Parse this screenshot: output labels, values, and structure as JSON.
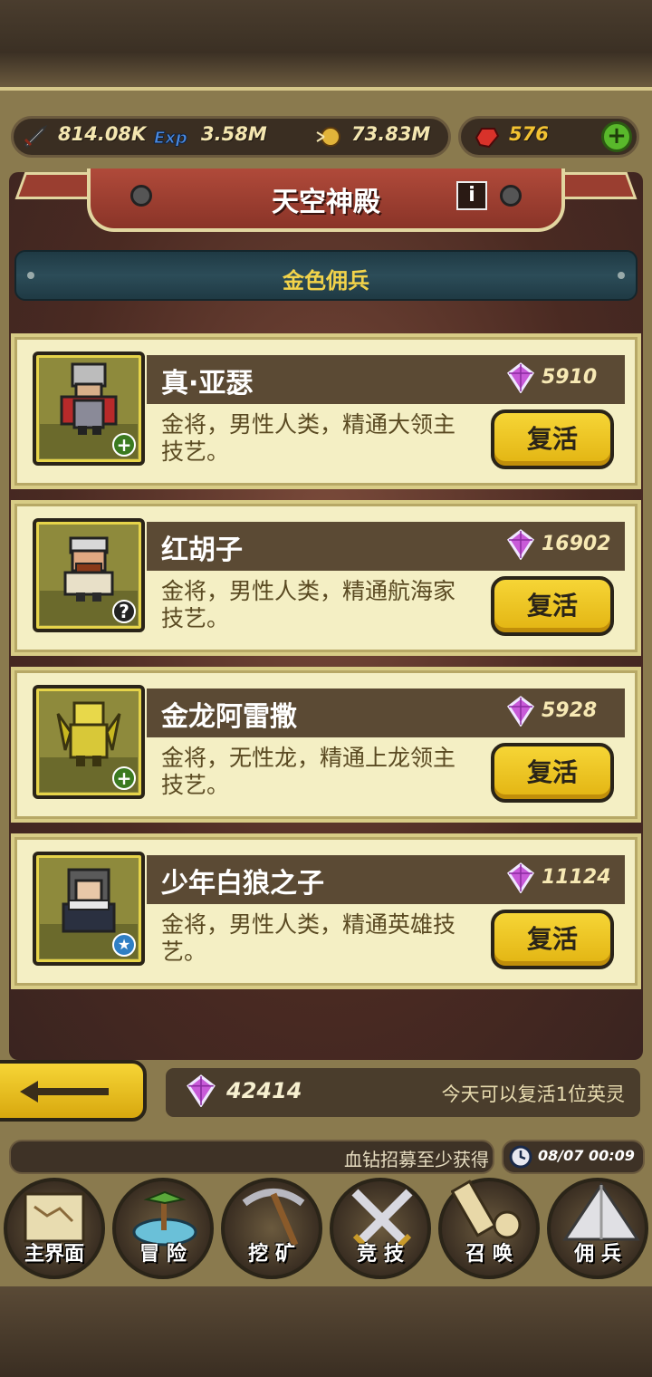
{
  "resources": {
    "attack": "814.08K",
    "exp": "3.58M",
    "gold": "73.83M",
    "gems": "576",
    "add_label": "+"
  },
  "header": {
    "title": "天空神殿",
    "info_label": "i",
    "subtitle": "金色佣兵"
  },
  "heroes": [
    {
      "name": "真·亚瑟",
      "cost": "5910",
      "desc": "金将，男性人类，精通大领主技艺。",
      "badge": "+",
      "button": "复活"
    },
    {
      "name": "红胡子",
      "cost": "16902",
      "desc": "金将，男性人类，精通航海家技艺。",
      "badge": "?",
      "button": "复活"
    },
    {
      "name": "金龙阿雷撒",
      "cost": "5928",
      "desc": "金将，无性龙，精通上龙领主技艺。",
      "badge": "+",
      "button": "复活"
    },
    {
      "name": "少年白狼之子",
      "cost": "11124",
      "desc": "金将，男性人类，精通英雄技艺。",
      "badge": "★",
      "button": "复活"
    }
  ],
  "footer": {
    "gem_total": "42414",
    "revive_note": "今天可以复活1位英灵",
    "recruit_text": "血钻招募至少获得",
    "timer": "08/07 00:09"
  },
  "nav": [
    {
      "label": "主界面",
      "icon": "scroll-map-icon"
    },
    {
      "label": "冒 险",
      "icon": "island-icon"
    },
    {
      "label": "挖 矿",
      "icon": "pickaxe-icon"
    },
    {
      "label": "竞 技",
      "icon": "crossed-swords-icon"
    },
    {
      "label": "召 唤",
      "icon": "summon-scroll-icon"
    },
    {
      "label": "佣 兵",
      "icon": "tent-icon"
    }
  ]
}
